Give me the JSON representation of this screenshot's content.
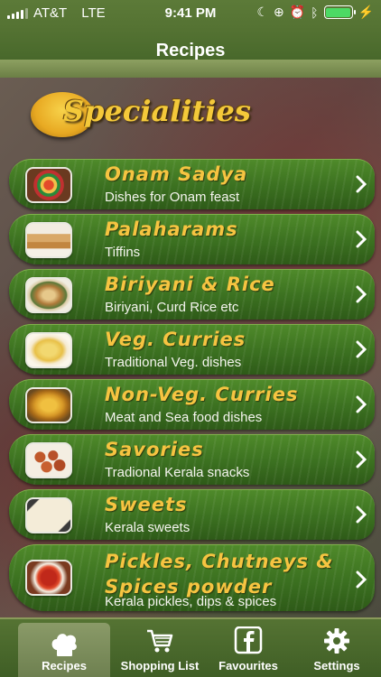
{
  "status": {
    "carrier": "AT&T",
    "network": "LTE",
    "time": "9:41 PM"
  },
  "nav": {
    "title": "Recipes"
  },
  "banner": {
    "title": "Specialities"
  },
  "items": [
    {
      "title": "Onam Sadya",
      "subtitle": "Dishes for Onam feast"
    },
    {
      "title": "Palaharams",
      "subtitle": "Tiffins"
    },
    {
      "title": "Biriyani & Rice",
      "subtitle": "Biriyani, Curd Rice etc"
    },
    {
      "title": "Veg. Curries",
      "subtitle": "Traditional Veg. dishes"
    },
    {
      "title": "Non-Veg. Curries",
      "subtitle": "Meat and Sea food dishes"
    },
    {
      "title": "Savories",
      "subtitle": "Tradional Kerala snacks"
    },
    {
      "title": "Sweets",
      "subtitle": "Kerala sweets"
    },
    {
      "title": "Pickles, Chutneys & Spices powder",
      "subtitle": "Kerala pickles, dips & spices"
    }
  ],
  "tabs": [
    {
      "label": "Recipes",
      "icon": "chef-hat-icon",
      "active": true
    },
    {
      "label": "Shopping List",
      "icon": "cart-icon",
      "active": false
    },
    {
      "label": "Favourites",
      "icon": "facebook-icon",
      "active": false
    },
    {
      "label": "Settings",
      "icon": "gear-icon",
      "active": false
    }
  ]
}
